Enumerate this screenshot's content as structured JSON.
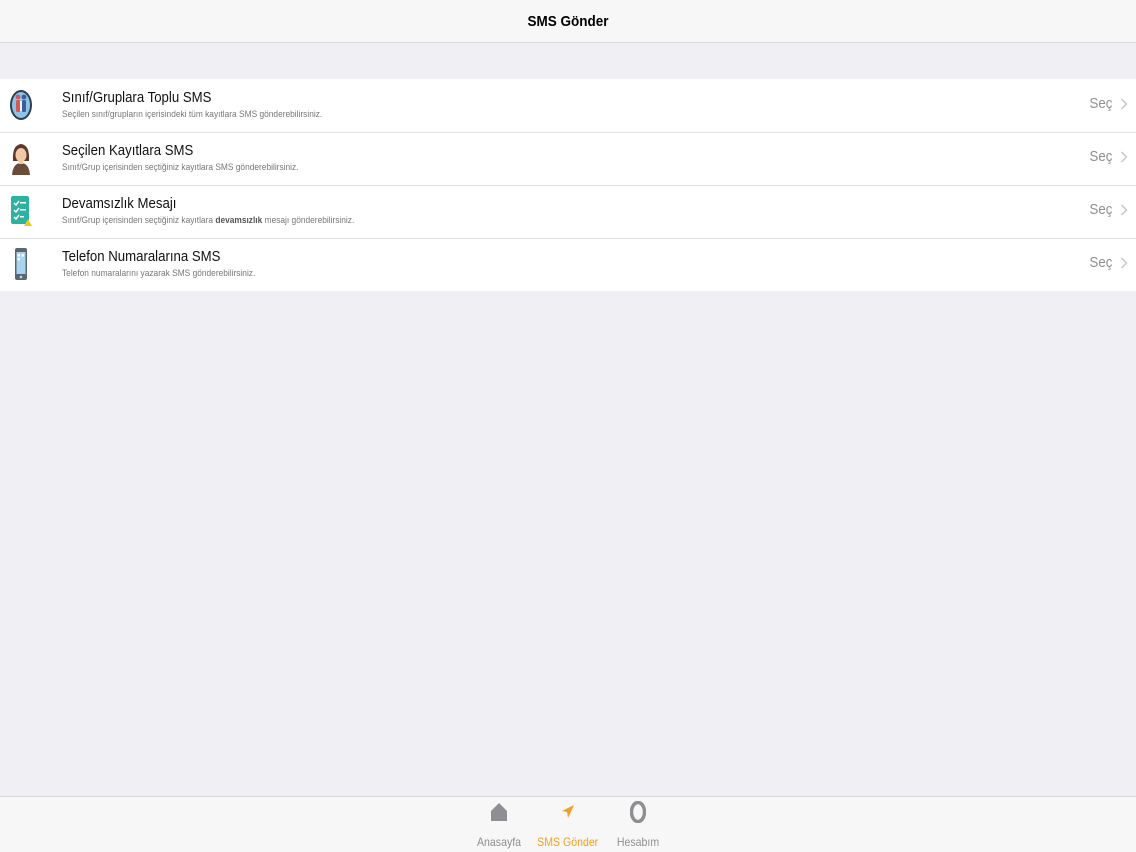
{
  "navbar": {
    "title": "SMS Gönder"
  },
  "list": {
    "rows": [
      {
        "title": "Sınıf/Gruplara Toplu SMS",
        "subtitle": "Seçilen sınıf/grupların içerisindeki tüm kayıtlara SMS gönderebilirsiniz.",
        "detail": "Seç",
        "icon": "group-people-icon"
      },
      {
        "title": "Seçilen Kayıtlara SMS",
        "subtitle": "Sınıf/Grup içerisinden seçtiğiniz kayıtlara SMS gönderebilirsiniz.",
        "detail": "Seç",
        "icon": "person-avatar-icon"
      },
      {
        "title": "Devamsızlık Mesajı",
        "subtitle_pre": "Sınıf/Grup içerisinden seçtiğiniz kayıtlara ",
        "subtitle_bold": "devamsızlık",
        "subtitle_post": " mesajı gönderebilirsiniz.",
        "detail": "Seç",
        "icon": "checklist-icon"
      },
      {
        "title": "Telefon Numaralarına SMS",
        "subtitle": "Telefon numaralarını yazarak SMS gönderebilirsiniz.",
        "detail": "Seç",
        "icon": "phone-icon"
      }
    ]
  },
  "tabbar": {
    "tabs": [
      {
        "label": "Anasayfa",
        "icon": "home-icon"
      },
      {
        "label": "SMS Gönder",
        "icon": "send-arrow-icon",
        "active": true
      },
      {
        "label": "Hesabım",
        "icon": "account-icon"
      }
    ]
  },
  "colors": {
    "accent": "#f0a020",
    "inactive": "#8e8e93"
  }
}
